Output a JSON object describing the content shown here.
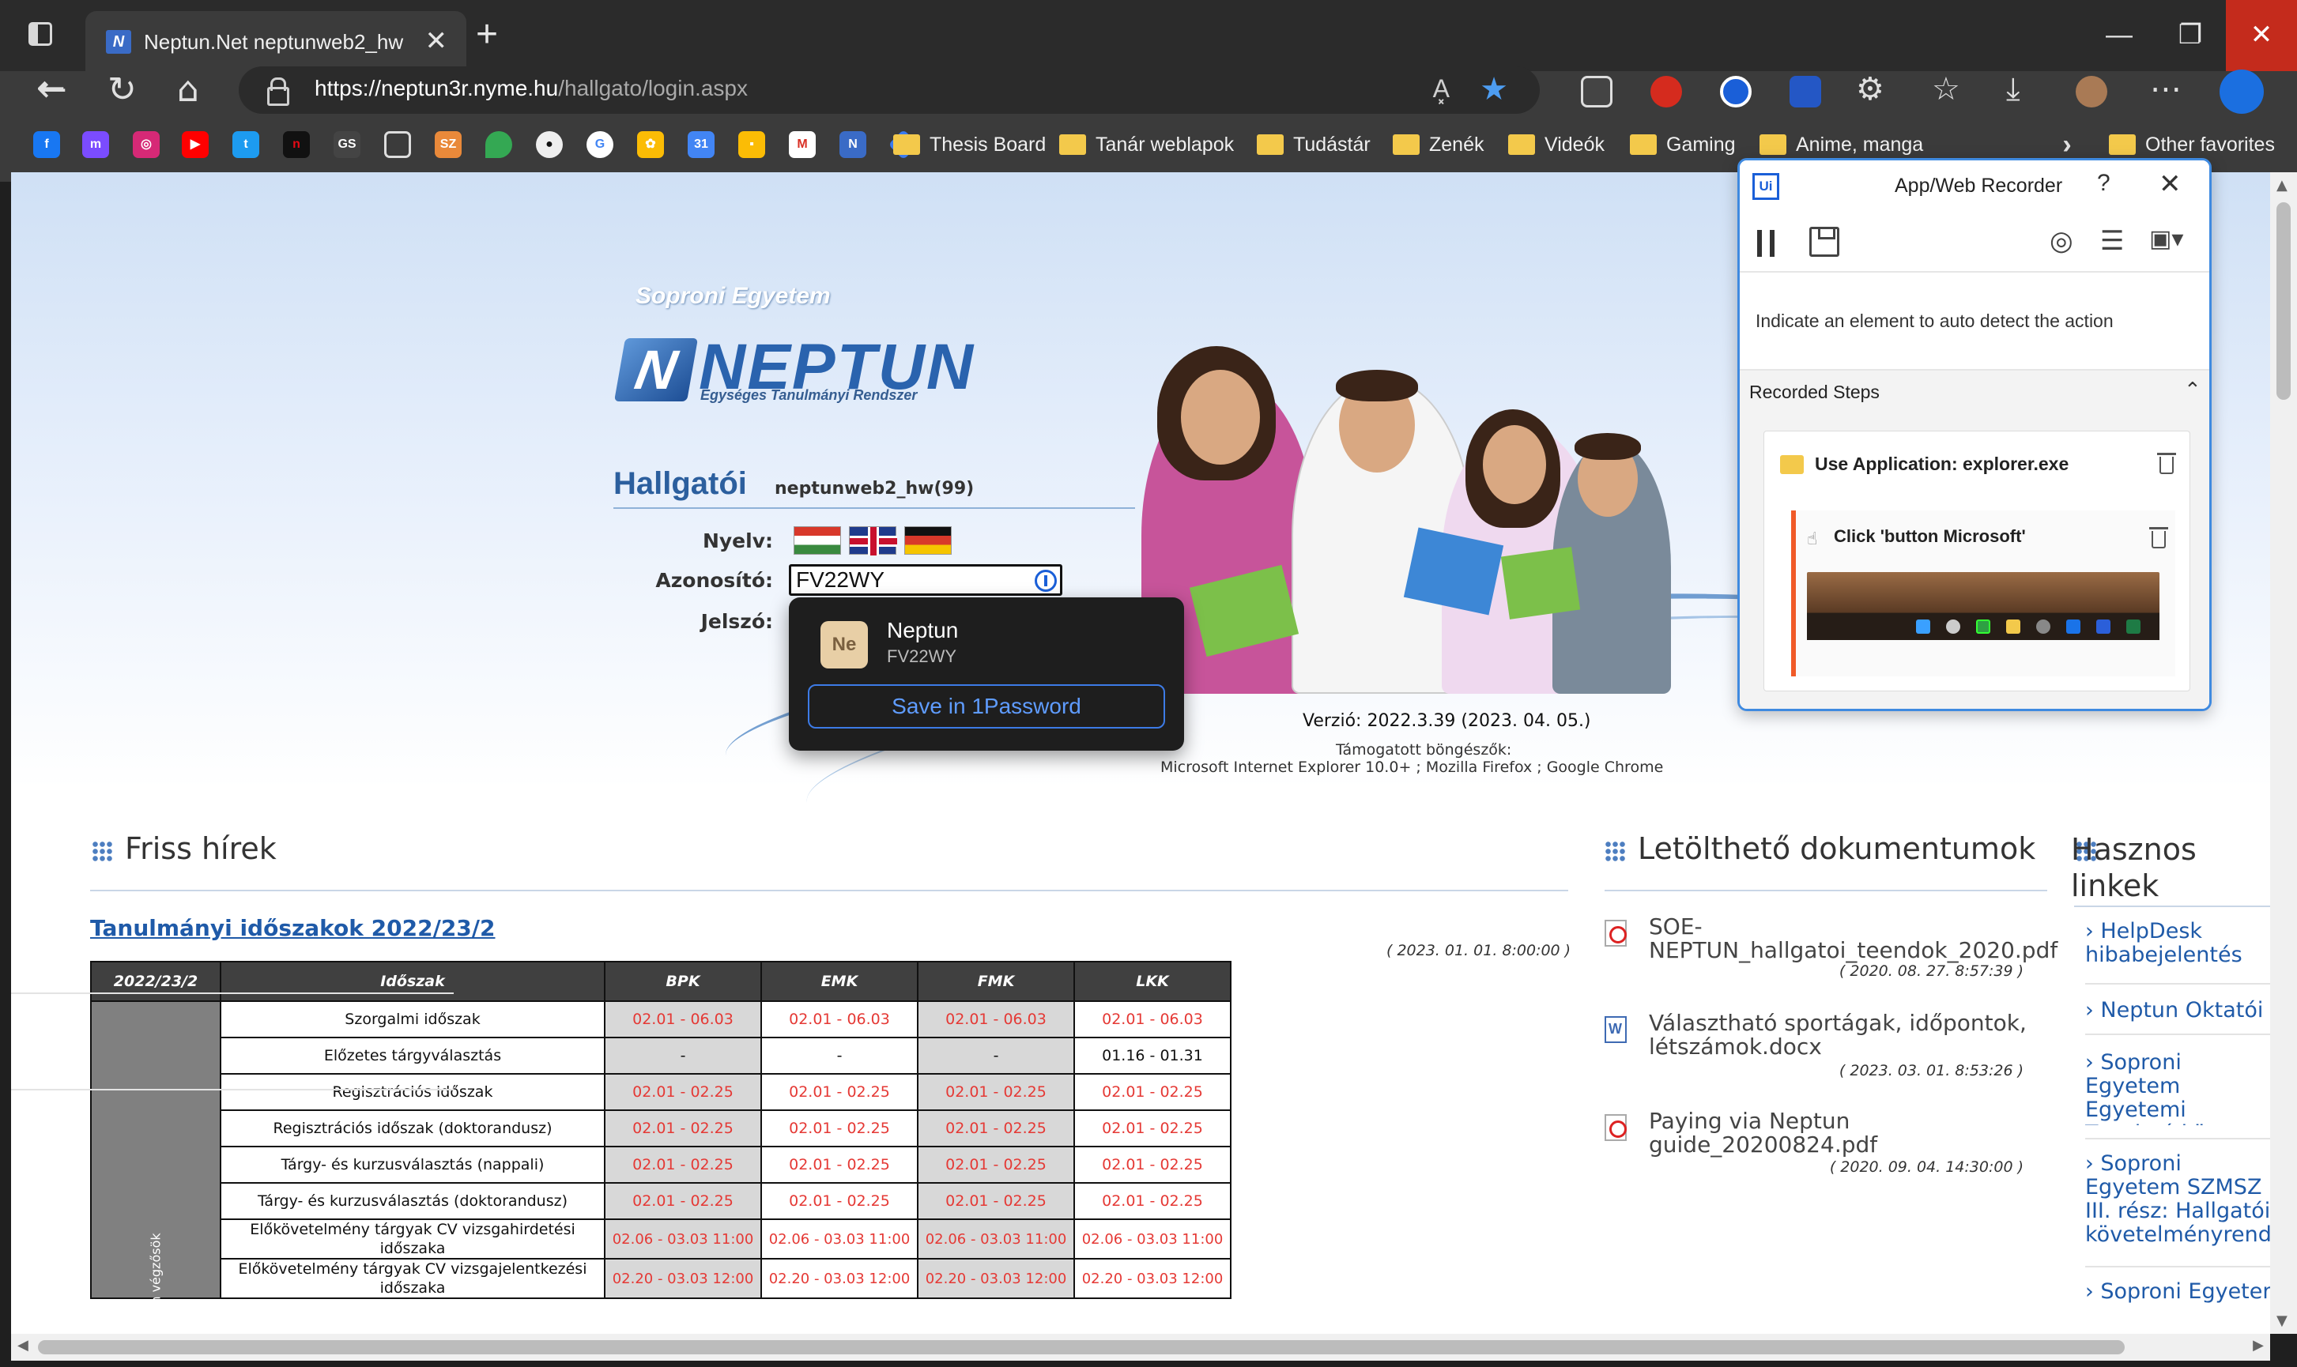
{
  "browser": {
    "tab_title": "Neptun.Net neptunweb2_hw",
    "tab_favicon": "neptun-favicon",
    "tab_close": "✕",
    "new_tab": "+",
    "url_host": "https://neptun3r.nyme.hu",
    "url_path": "/hallgato/login.aspx",
    "read_aloud": "A͓",
    "window_buttons": {
      "minimize": "—",
      "restore": "❐",
      "close": "✕"
    }
  },
  "bookmarks": {
    "folders": [
      "Thesis Board",
      "Tanár weblapok",
      "Tudástár",
      "Zenék",
      "Videók",
      "Gaming",
      "Anime, manga"
    ],
    "other": "Other favorites",
    "overflow": "›",
    "icons": [
      "facebook-icon",
      "messenger-icon",
      "instagram-icon",
      "youtube-icon",
      "twitter-icon",
      "netflix-icon",
      "gs-icon",
      "document-icon",
      "sz-icon",
      "maps-icon",
      "github-icon",
      "google-icon",
      "photos-icon",
      "calendar-icon",
      "keep-icon",
      "gmail-icon",
      "neptun-icon"
    ],
    "gs_label": "GS",
    "sz_label": "SZ",
    "netflix_label": "n"
  },
  "page": {
    "school": "Soproni Egyetem",
    "logo_text": "NEPTUN",
    "logo_sub": "Egységes Tanulmányi Rendszer",
    "logo_mark": "N",
    "heading": "Hallgatói",
    "heading_sub": "neptunweb2_hw(99)",
    "lang_label": "Nyelv:",
    "id_label": "Azonosító:",
    "pw_label": "Jelszó:",
    "id_value": "FV22WY",
    "version": "Verzió: 2022.3.39 (2023. 04. 05.)",
    "supported_label": "Támogatott böngészők:",
    "supported_list": "Microsoft Internet Explorer 10.0+ ; Mozilla Firefox ; Google Chrome"
  },
  "password_popup": {
    "avatar": "Ne",
    "name": "Neptun",
    "user": "FV22WY",
    "save_label": "Save in 1Password"
  },
  "news": {
    "title": "Friss hírek",
    "item_link": "Tanulmányi időszakok 2022/23/2",
    "item_date": "( 2023. 01. 01. 8:00:00 )",
    "table": {
      "headers": [
        "2022/23/2",
        "Időszak",
        "BPK",
        "EMK",
        "FMK",
        "LKK"
      ],
      "side_label": "n végzősök",
      "rows": [
        {
          "label": "Szorgalmi időszak",
          "values": [
            "02.01 - 06.03",
            "02.01 - 06.03",
            "02.01 - 06.03",
            "02.01 - 06.03"
          ]
        },
        {
          "label": "Előzetes tárgyválasztás",
          "values": [
            "-",
            "-",
            "-",
            "01.16 - 01.31"
          ]
        },
        {
          "label": "Regisztrációs időszak",
          "values": [
            "02.01 - 02.25",
            "02.01 - 02.25",
            "02.01 - 02.25",
            "02.01 - 02.25"
          ]
        },
        {
          "label": "Regisztrációs időszak (doktorandusz)",
          "values": [
            "02.01 - 02.25",
            "02.01 - 02.25",
            "02.01 - 02.25",
            "02.01 - 02.25"
          ]
        },
        {
          "label": "Tárgy- és kurzusválasztás (nappali)",
          "values": [
            "02.01 - 02.25",
            "02.01 - 02.25",
            "02.01 - 02.25",
            "02.01 - 02.25"
          ]
        },
        {
          "label": "Tárgy- és kurzusválasztás (doktorandusz)",
          "values": [
            "02.01 - 02.25",
            "02.01 - 02.25",
            "02.01 - 02.25",
            "02.01 - 02.25"
          ]
        },
        {
          "label": "Előkövetelmény tárgyak CV vizsgahirdetési időszaka",
          "values": [
            "02.06 - 03.03 11:00",
            "02.06 - 03.03 11:00",
            "02.06 - 03.03 11:00",
            "02.06 - 03.03 11:00"
          ]
        },
        {
          "label": "Előkövetelmény tárgyak CV vizsgajelentkezési időszaka",
          "values": [
            "02.20 - 03.03 12:00",
            "02.20 - 03.03 12:00",
            "02.20 - 03.03 12:00",
            "02.20 - 03.03 12:00"
          ]
        }
      ]
    }
  },
  "downloads": {
    "title": "Letölthető dokumentumok",
    "items": [
      {
        "name": "SOE-NEPTUN_hallgatoi_teendok_2020.pdf",
        "date": "( 2020. 08. 27. 8:57:39 )"
      },
      {
        "name": "Választható sportágak, időpontok, létszámok.docx",
        "date": "( 2023. 03. 01. 8:53:26 )"
      },
      {
        "name": "Paying via Neptun guide_20200824.pdf",
        "date": "( 2020. 09. 04. 14:30:00 )"
      }
    ]
  },
  "useful": {
    "title": "Hasznos linkek",
    "items": [
      "› HelpDesk hibabejelentés",
      "› Neptun Oktatói w",
      "› Soproni Egyetem Egyetemi Tanulmá központ",
      "› Soproni Egyetem SZMSZ III. rész: Hallgatói követelményrends",
      "› Soproni Egyetem"
    ]
  },
  "recorder": {
    "logo": "Ui",
    "title": "App/Web Recorder",
    "help": "?",
    "close": "✕",
    "hint": "Indicate an element to auto detect the action",
    "steps_title": "Recorded Steps",
    "chevron": "⌃",
    "step_title": "Use Application: explorer.exe",
    "sub_step_title": "Click 'button Microsoft'",
    "click_glyph": "☝"
  },
  "colors": {
    "accent": "#3f8ae0",
    "neptun_blue": "#2a63ae",
    "schedule_red": "#e53935",
    "close_red": "#c42b1c"
  }
}
